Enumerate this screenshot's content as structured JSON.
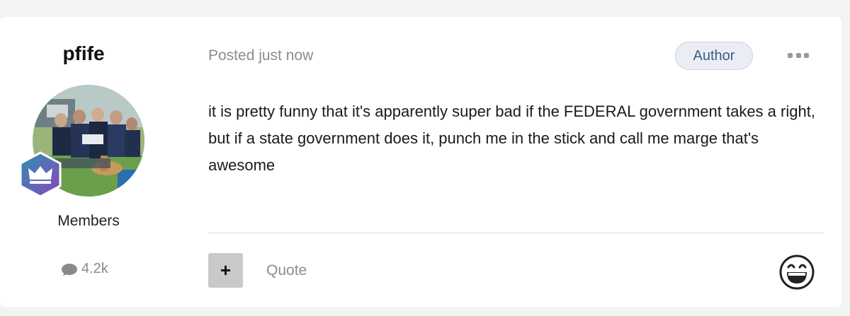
{
  "author": {
    "username": "pfife",
    "group": "Members",
    "post_count": "4.2k",
    "avatar_icon": "avatar-photo",
    "rank_icon": "crown-icon"
  },
  "post": {
    "meta": "Posted just now",
    "author_badge": "Author",
    "body": "it is pretty funny that it's apparently super bad if the FEDERAL government takes a right, but if a state government does it, punch me in the stick and call me marge that's awesome"
  },
  "actions": {
    "multiquote_label": "+",
    "quote_label": "Quote",
    "reaction_icon": "laughing-face-icon"
  },
  "colors": {
    "badge_bg": "#eaeef4",
    "badge_text": "#3d5a86",
    "rank_gradient_start": "#2f8fb6",
    "rank_gradient_end": "#8a47b8"
  }
}
